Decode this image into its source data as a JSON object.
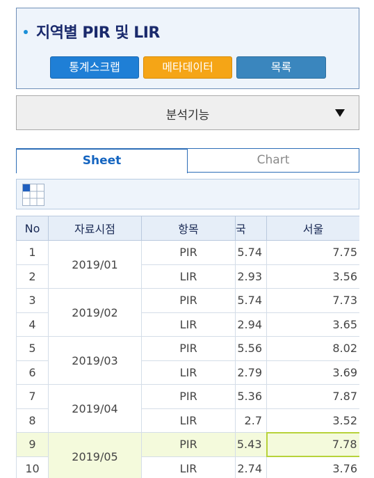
{
  "header": {
    "title": "지역별 PIR 및 LIR",
    "buttons": {
      "scrap": "통계스크랩",
      "metadata": "메타데이터",
      "list": "목록"
    }
  },
  "analysis": {
    "label": "분석기능"
  },
  "tabs": {
    "sheet": "Sheet",
    "chart": "Chart"
  },
  "table": {
    "headers": {
      "no": "No",
      "date": "자료시점",
      "item": "항목",
      "partial": "국",
      "seoul": "서울"
    },
    "groups": [
      {
        "date": "2019/01",
        "rows": [
          {
            "no": "1",
            "item": "PIR",
            "val": "5.74",
            "seoul": "7.75"
          },
          {
            "no": "2",
            "item": "LIR",
            "val": "2.93",
            "seoul": "3.56"
          }
        ]
      },
      {
        "date": "2019/02",
        "rows": [
          {
            "no": "3",
            "item": "PIR",
            "val": "5.74",
            "seoul": "7.73"
          },
          {
            "no": "4",
            "item": "LIR",
            "val": "2.94",
            "seoul": "3.65"
          }
        ]
      },
      {
        "date": "2019/03",
        "rows": [
          {
            "no": "5",
            "item": "PIR",
            "val": "5.56",
            "seoul": "8.02"
          },
          {
            "no": "6",
            "item": "LIR",
            "val": "2.79",
            "seoul": "3.69"
          }
        ]
      },
      {
        "date": "2019/04",
        "rows": [
          {
            "no": "7",
            "item": "PIR",
            "val": "5.36",
            "seoul": "7.87"
          },
          {
            "no": "8",
            "item": "LIR",
            "val": "2.7",
            "seoul": "3.52"
          }
        ]
      },
      {
        "date": "2019/05",
        "rows": [
          {
            "no": "9",
            "item": "PIR",
            "val": "5.43",
            "seoul": "7.78"
          },
          {
            "no": "10",
            "item": "LIR",
            "val": "2.74",
            "seoul": "3.76"
          }
        ]
      }
    ]
  },
  "colors": {
    "title": "#1a2a6c",
    "scrap_button": "#1f7fd6",
    "meta_button": "#f5a516",
    "list_button": "#3a86be",
    "selected_border": "#b7d23a",
    "highlight_row": "#f4fadc"
  },
  "icons": {
    "bullet": "bullet-dot-icon",
    "dropdown": "triangle-down-icon",
    "grid": "grid-select-icon"
  }
}
